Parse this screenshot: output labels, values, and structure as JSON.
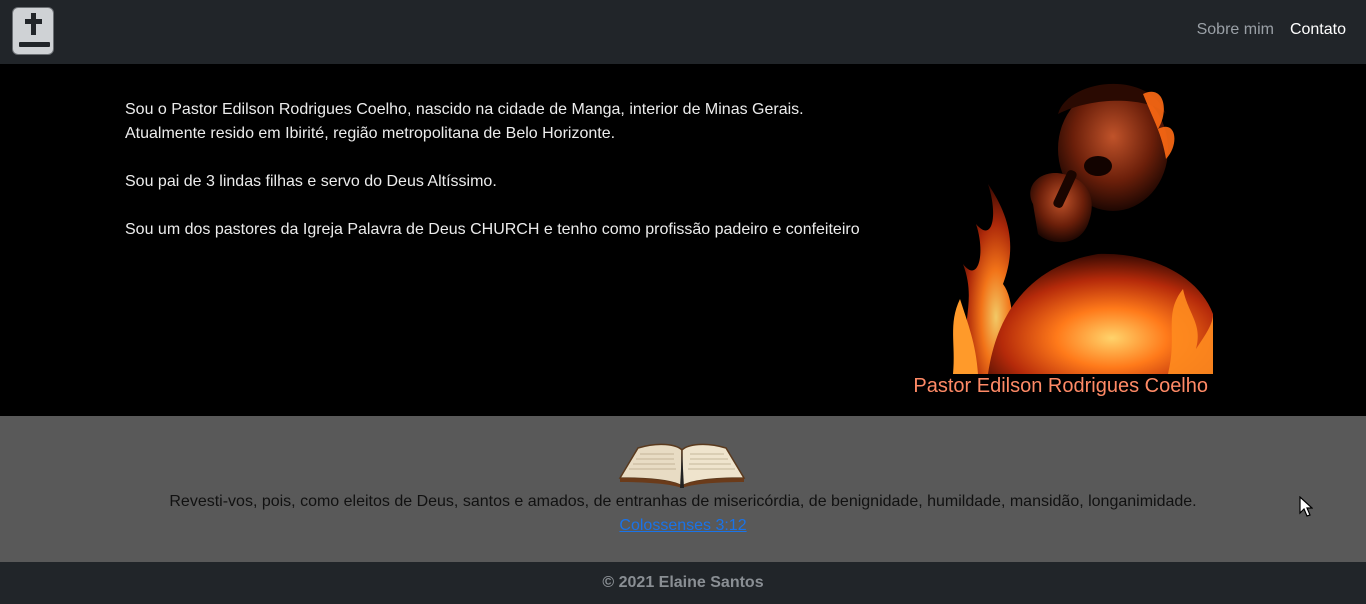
{
  "navbar": {
    "brand_icon": "bible-cross-icon",
    "links": [
      {
        "label": "Sobre mim"
      },
      {
        "label": "Contato"
      }
    ]
  },
  "about": {
    "paragraphs": [
      "Sou o Pastor Edilson Rodrigues Coelho, nascido na cidade de Manga, interior de Minas Gerais.",
      "Atualmente resido em Ibirité, região metropolitana de Belo Horizonte.",
      "Sou pai de 3 lindas filhas e servo do Deus Altíssimo.",
      "Sou um dos pastores da Igreja Palavra de Deus CHURCH e tenho como profissão padeiro e confeiteiro"
    ],
    "photo_caption": "Pastor Edilson Rodrigues Coelho"
  },
  "verse": {
    "text": "Revesti-vos, pois, como eleitos de Deus, santos e amados, de entranhas de misericórdia, de benignidade, humildade, mansidão, longanimidade.",
    "reference": "Colossenses 3:12"
  },
  "footer": {
    "copyright": "© 2021 Elaine Santos"
  },
  "colors": {
    "navbar_bg": "#212529",
    "hero_bg": "#000000",
    "verse_bg": "#595959",
    "caption": "#ff8a66",
    "link": "#1a73e8"
  }
}
